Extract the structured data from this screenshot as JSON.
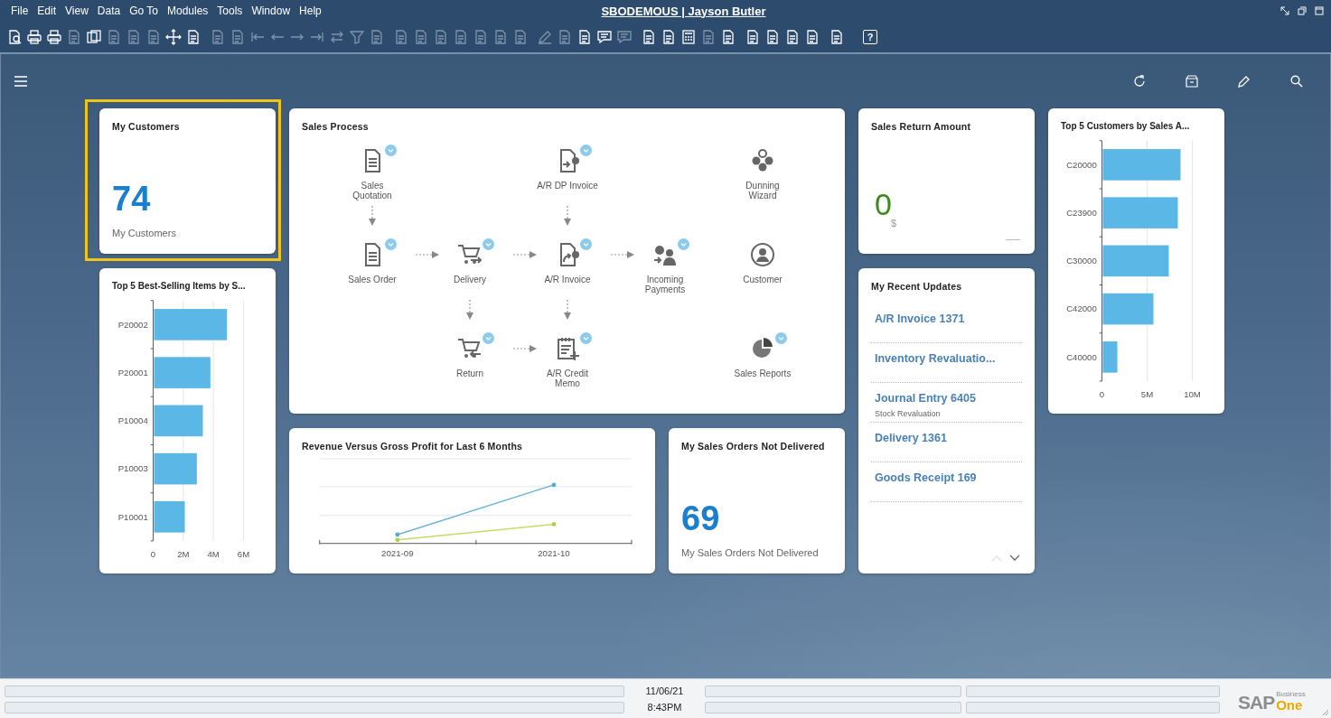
{
  "menu": [
    "File",
    "Edit",
    "View",
    "Data",
    "Go To",
    "Modules",
    "Tools",
    "Window",
    "Help"
  ],
  "window": {
    "title": "SBODEMOUS | Jayson Butler"
  },
  "toolbar": {
    "groups": [
      {
        "items": [
          {
            "disabled": false
          },
          {
            "disabled": false
          },
          {
            "disabled": false
          },
          {
            "disabled": true
          },
          {
            "disabled": false
          },
          {
            "disabled": true
          },
          {
            "disabled": true
          },
          {
            "disabled": true
          },
          {
            "disabled": false
          },
          {
            "disabled": false
          }
        ]
      },
      {
        "items": [
          {
            "disabled": true
          },
          {
            "disabled": true
          },
          {
            "disabled": true
          },
          {
            "disabled": true
          },
          {
            "disabled": true
          },
          {
            "disabled": true
          },
          {
            "disabled": true
          },
          {
            "disabled": true
          },
          {
            "disabled": true
          }
        ]
      },
      {
        "items": [
          {
            "disabled": true
          },
          {
            "disabled": true
          },
          {
            "disabled": true
          },
          {
            "disabled": true
          },
          {
            "disabled": true
          },
          {
            "disabled": true
          },
          {
            "disabled": true
          }
        ]
      },
      {
        "items": [
          {
            "disabled": true
          },
          {
            "disabled": true
          },
          {
            "disabled": false
          },
          {
            "disabled": false
          },
          {
            "disabled": true
          }
        ]
      },
      {
        "items": [
          {
            "disabled": false
          },
          {
            "disabled": false
          },
          {
            "disabled": false
          },
          {
            "disabled": true
          },
          {
            "disabled": false
          }
        ]
      },
      {
        "items": [
          {
            "disabled": false
          },
          {
            "disabled": false
          },
          {
            "disabled": false
          },
          {
            "disabled": false
          }
        ]
      },
      {
        "items": [
          {
            "disabled": false
          }
        ]
      },
      {
        "items": [
          {
            "disabled": false,
            "label": "?"
          }
        ]
      }
    ]
  },
  "tiles": [
    {
      "kind": "count",
      "selected": true,
      "title": "My Customers",
      "value": "74",
      "caption": "My Customers"
    },
    {
      "kind": "process",
      "selected": false,
      "title": "Sales Process",
      "rows": [
        [
          {
            "kind": "quotation",
            "label": "Sales Quotation",
            "badge": true,
            "arrow_right": false,
            "arrow_down": true
          },
          null,
          {
            "kind": "dp-invoice",
            "label": "A/R DP Invoice",
            "badge": true,
            "arrow_right": false,
            "arrow_down": true
          },
          null,
          {
            "kind": "dunning",
            "label": "Dunning Wizard",
            "badge": false,
            "arrow_right": false,
            "arrow_down": false
          }
        ],
        [
          {
            "kind": "order",
            "label": "Sales Order",
            "badge": true,
            "arrow_right": true,
            "arrow_down": false
          },
          {
            "kind": "delivery",
            "label": "Delivery",
            "badge": true,
            "arrow_right": true,
            "arrow_down": true
          },
          {
            "kind": "invoice",
            "label": "A/R Invoice",
            "badge": true,
            "arrow_right": true,
            "arrow_down": true
          },
          {
            "kind": "payment",
            "label": "Incoming Payments",
            "badge": true,
            "arrow_right": false,
            "arrow_down": false
          },
          {
            "kind": "customer",
            "label": "Customer",
            "badge": false,
            "arrow_right": false,
            "arrow_down": false
          }
        ],
        [
          null,
          {
            "kind": "return",
            "label": "Return",
            "badge": true,
            "arrow_right": true,
            "arrow_down": false
          },
          {
            "kind": "credit-memo",
            "label": "A/R Credit Memo",
            "badge": true,
            "arrow_right": false,
            "arrow_down": false
          },
          null,
          {
            "kind": "reports",
            "label": "Sales Reports",
            "badge": true,
            "arrow_right": false,
            "arrow_down": false
          }
        ]
      ]
    },
    {
      "kind": "amount",
      "selected": false,
      "title": "Sales Return Amount",
      "value": "0",
      "unit": "$"
    },
    {
      "kind": "bar-chart",
      "selected": false,
      "title": "Top 5 Customers by Sales A...",
      "chart_data": {
        "type": "bar",
        "orientation": "horizontal",
        "categories": [
          "C20000",
          "C23900",
          "C30000",
          "C42000",
          "C40000"
        ],
        "values": [
          8700000,
          8400000,
          7400000,
          5700000,
          1700000
        ],
        "xlim": [
          0,
          10000000
        ],
        "xticks": [
          {
            "value": 0,
            "label": "0"
          },
          {
            "value": 5000000,
            "label": "5M"
          },
          {
            "value": 10000000,
            "label": "10M"
          }
        ]
      }
    },
    {
      "kind": "bar-chart",
      "selected": false,
      "title": "Top 5 Best-Selling Items by S...",
      "chart_data": {
        "type": "bar",
        "orientation": "horizontal",
        "categories": [
          "P20002",
          "P20001",
          "P10004",
          "P10003",
          "P10001"
        ],
        "values": [
          4900000,
          3800000,
          3300000,
          2900000,
          2100000
        ],
        "xlim": [
          0,
          6000000
        ],
        "xticks": [
          {
            "value": 0,
            "label": "0"
          },
          {
            "value": 2000000,
            "label": "2M"
          },
          {
            "value": 4000000,
            "label": "4M"
          },
          {
            "value": 6000000,
            "label": "6M"
          }
        ]
      }
    },
    {
      "kind": "updates",
      "selected": false,
      "title": "My Recent Updates",
      "items": [
        {
          "label": "A/R Invoice 1371"
        },
        {
          "label": "Inventory Revaluatio..."
        },
        {
          "label": "Journal Entry 6405",
          "note": "Stock Revaluation"
        },
        {
          "label": "Delivery 1361"
        },
        {
          "label": "Goods Receipt 169"
        }
      ],
      "pager": {
        "up_disabled": true,
        "down_disabled": false
      }
    },
    {
      "kind": "line-chart",
      "selected": false,
      "title": "Revenue Versus Gross Profit for Last 6 Months",
      "x_labels": [
        "2021-09",
        "2021-10"
      ]
    },
    {
      "kind": "count",
      "selected": false,
      "title": "My Sales Orders Not Delivered",
      "value": "69",
      "caption": "My Sales Orders Not Delivered"
    }
  ],
  "status_bar": {
    "date": "11/06/21",
    "time": "8:43PM",
    "logo": {
      "brand": "SAP",
      "product_top": "Business",
      "product": "One"
    }
  }
}
